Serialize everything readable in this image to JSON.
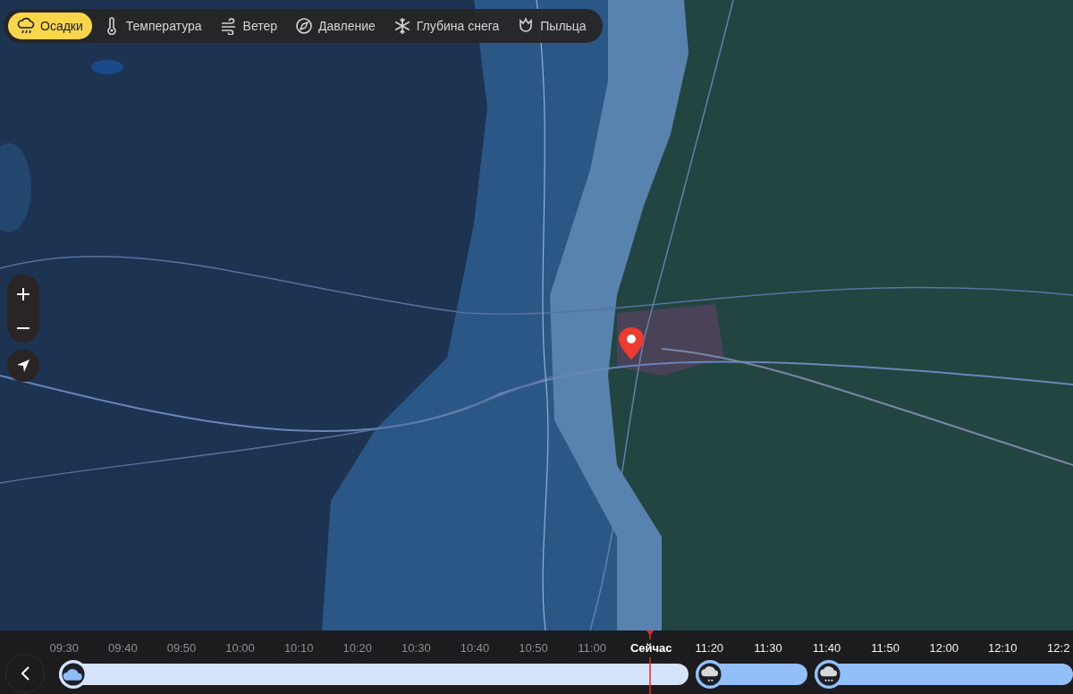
{
  "layers": [
    {
      "label": "Осадки",
      "selected": true
    },
    {
      "label": "Температура",
      "selected": false
    },
    {
      "label": "Ветер",
      "selected": false
    },
    {
      "label": "Давление",
      "selected": false
    },
    {
      "label": "Глубина снега",
      "selected": false
    },
    {
      "label": "Пыльца",
      "selected": false
    }
  ],
  "timeline": {
    "times": [
      {
        "label": "09:30",
        "past": true
      },
      {
        "label": "09:40",
        "past": true
      },
      {
        "label": "09:50",
        "past": true
      },
      {
        "label": "10:00",
        "past": true
      },
      {
        "label": "10:10",
        "past": true
      },
      {
        "label": "10:20",
        "past": true
      },
      {
        "label": "10:30",
        "past": true
      },
      {
        "label": "10:40",
        "past": true
      },
      {
        "label": "10:50",
        "past": true
      },
      {
        "label": "11:00",
        "past": true
      },
      {
        "label": "Сейчас",
        "kind": "now"
      },
      {
        "label": "11:20",
        "past": false
      },
      {
        "label": "11:30",
        "past": false
      },
      {
        "label": "11:40",
        "past": false
      },
      {
        "label": "11:50",
        "past": false
      },
      {
        "label": "12:00",
        "past": false
      },
      {
        "label": "12:10",
        "past": false
      },
      {
        "label": "12:2",
        "past": false
      }
    ],
    "segments": [
      {
        "kind": "cloud",
        "color": "#d6e4fb"
      },
      {
        "kind": "light_rain",
        "color": "#93bff8"
      },
      {
        "kind": "rain",
        "color": "#93bff8"
      }
    ]
  }
}
